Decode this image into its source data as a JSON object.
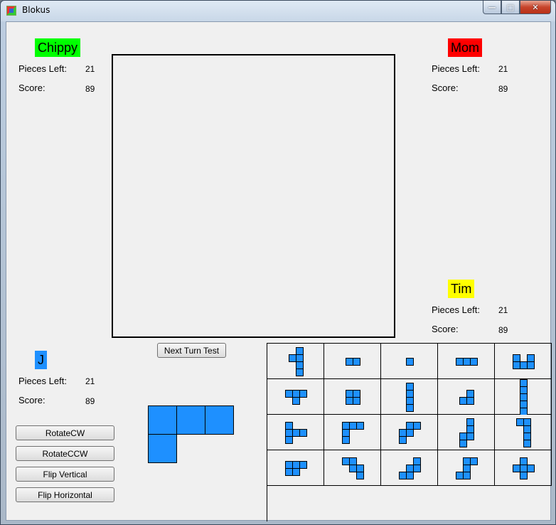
{
  "window": {
    "title": "Blokus"
  },
  "colors": {
    "piece": "#1e90ff",
    "chippy": "#00ff00",
    "mom": "#ff0000",
    "tim": "#ffff00",
    "j": "#1e90ff"
  },
  "players": [
    {
      "id": "chippy",
      "name": "Chippy",
      "pieces_left_label": "Pieces Left:",
      "pieces_left": "21",
      "score_label": "Score:",
      "score": "89",
      "color": "#00ff00"
    },
    {
      "id": "mom",
      "name": "Mom",
      "pieces_left_label": "Pieces Left:",
      "pieces_left": "21",
      "score_label": "Score:",
      "score": "89",
      "color": "#ff0000"
    },
    {
      "id": "tim",
      "name": "Tim",
      "pieces_left_label": "Pieces Left:",
      "pieces_left": "21",
      "score_label": "Score:",
      "score": "89",
      "color": "#ffff00"
    },
    {
      "id": "j",
      "name": "J",
      "pieces_left_label": "Pieces Left:",
      "pieces_left": "21",
      "score_label": "Score:",
      "score": "89",
      "color": "#1e90ff"
    }
  ],
  "buttons": {
    "next_turn": "Next Turn Test",
    "rotate_cw": "RotateCW",
    "rotate_ccw": "RotateCCW",
    "flip_vertical": "Flip Vertical",
    "flip_horizontal": "Flip Horizontal"
  },
  "current_piece": {
    "cells": [
      [
        0,
        0
      ],
      [
        1,
        0
      ],
      [
        2,
        0
      ],
      [
        0,
        1
      ]
    ]
  },
  "palette": {
    "pieces": [
      [
        [
          1,
          0
        ],
        [
          0,
          1
        ],
        [
          1,
          1
        ],
        [
          1,
          2
        ],
        [
          1,
          3
        ]
      ],
      [
        [
          0,
          0
        ],
        [
          1,
          0
        ]
      ],
      [
        [
          0,
          0
        ]
      ],
      [
        [
          0,
          0
        ],
        [
          1,
          0
        ],
        [
          2,
          0
        ]
      ],
      [
        [
          0,
          0
        ],
        [
          2,
          0
        ],
        [
          0,
          1
        ],
        [
          1,
          1
        ],
        [
          2,
          1
        ]
      ],
      [
        [
          0,
          0
        ],
        [
          1,
          0
        ],
        [
          2,
          0
        ],
        [
          1,
          1
        ]
      ],
      [
        [
          0,
          0
        ],
        [
          1,
          0
        ],
        [
          0,
          1
        ],
        [
          1,
          1
        ]
      ],
      [
        [
          0,
          0
        ],
        [
          0,
          1
        ],
        [
          0,
          2
        ],
        [
          0,
          3
        ]
      ],
      [
        [
          1,
          0
        ],
        [
          0,
          1
        ],
        [
          1,
          1
        ]
      ],
      [
        [
          0,
          0
        ],
        [
          0,
          1
        ],
        [
          0,
          2
        ],
        [
          0,
          3
        ],
        [
          0,
          4
        ]
      ],
      [
        [
          0,
          0
        ],
        [
          0,
          1
        ],
        [
          1,
          1
        ],
        [
          2,
          1
        ],
        [
          0,
          2
        ]
      ],
      [
        [
          0,
          0
        ],
        [
          1,
          0
        ],
        [
          2,
          0
        ],
        [
          0,
          1
        ],
        [
          0,
          2
        ]
      ],
      [
        [
          1,
          0
        ],
        [
          2,
          0
        ],
        [
          0,
          1
        ],
        [
          1,
          1
        ],
        [
          0,
          2
        ]
      ],
      [
        [
          1,
          0
        ],
        [
          1,
          1
        ],
        [
          0,
          2
        ],
        [
          1,
          2
        ],
        [
          0,
          3
        ]
      ],
      [
        [
          0,
          0
        ],
        [
          1,
          0
        ],
        [
          1,
          1
        ],
        [
          1,
          2
        ],
        [
          1,
          3
        ]
      ],
      [
        [
          0,
          0
        ],
        [
          1,
          0
        ],
        [
          2,
          0
        ],
        [
          0,
          1
        ],
        [
          1,
          1
        ]
      ],
      [
        [
          0,
          0
        ],
        [
          1,
          0
        ],
        [
          1,
          1
        ],
        [
          2,
          1
        ],
        [
          2,
          2
        ]
      ],
      [
        [
          2,
          0
        ],
        [
          1,
          1
        ],
        [
          2,
          1
        ],
        [
          0,
          2
        ],
        [
          1,
          2
        ]
      ],
      [
        [
          2,
          0
        ],
        [
          1,
          0
        ],
        [
          1,
          1
        ],
        [
          1,
          2
        ],
        [
          0,
          2
        ]
      ],
      [
        [
          1,
          0
        ],
        [
          0,
          1
        ],
        [
          1,
          1
        ],
        [
          2,
          1
        ],
        [
          1,
          2
        ]
      ]
    ]
  }
}
